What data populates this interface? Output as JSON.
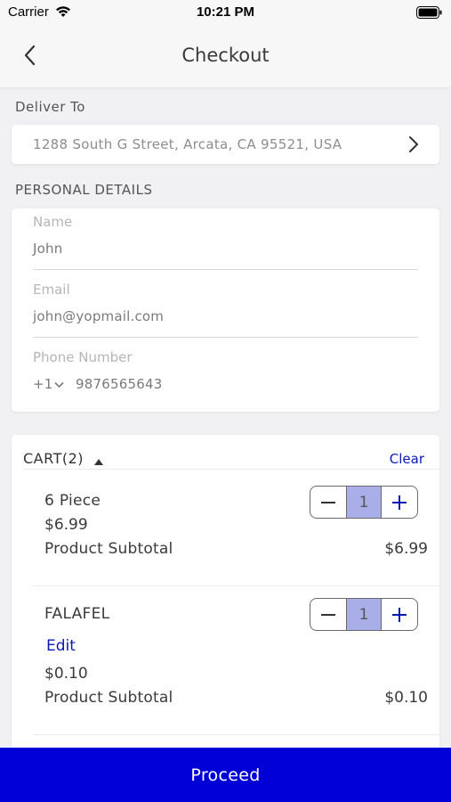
{
  "status_bar": {
    "carrier": "Carrier",
    "time": "10:21 PM"
  },
  "nav": {
    "title": "Checkout"
  },
  "deliver": {
    "label": "Deliver To",
    "address": "1288 South G Street, Arcata, CA 95521, USA"
  },
  "personal": {
    "label": "PERSONAL DETAILS",
    "name_label": "Name",
    "name_value": "John",
    "email_label": "Email",
    "email_value": "john@yopmail.com",
    "phone_label": "Phone Number",
    "phone_code": "+1",
    "phone_value": "9876565643"
  },
  "cart": {
    "title": "CART(2)",
    "clear_label": "Clear",
    "items": [
      {
        "name": "6 Piece",
        "price": "$6.99",
        "subtotal_label": "Product Subtotal",
        "subtotal": "$6.99",
        "quantity": "1"
      },
      {
        "name": "FALAFEL",
        "edit_label": "Edit",
        "price": "$0.10",
        "subtotal_label": "Product Subtotal",
        "subtotal": "$0.10",
        "quantity": "1"
      }
    ]
  },
  "proceed_label": "Proceed",
  "colors": {
    "accent": "#0000d6",
    "link": "#0a19b8",
    "qty_bg": "#a9aee8"
  }
}
